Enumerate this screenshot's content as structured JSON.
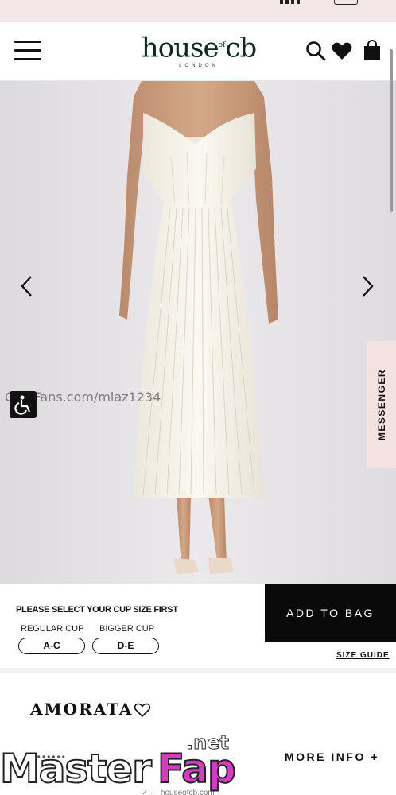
{
  "header": {
    "logo_brand": "house",
    "logo_brand_mid": "of",
    "logo_brand_end": "cb",
    "logo_sub": "LONDON"
  },
  "gallery": {
    "watermark": "OnlyFans.com/miaz1234",
    "messenger_label": "MESSENGER"
  },
  "cup_select": {
    "heading": "PLEASE SELECT YOUR CUP SIZE FIRST",
    "regular_label": "REGULAR CUP",
    "bigger_label": "BIGGER CUP",
    "regular_value": "A-C",
    "bigger_value": "D-E",
    "add_to_bag": "ADD TO BAG",
    "size_guide": "SIZE GUIDE"
  },
  "product": {
    "name": "AMORATA",
    "price": "£••••••",
    "more_info": "MORE INFO +",
    "url": "✓ ··· houseofcb.com"
  },
  "overlay": {
    "part1": "Master",
    "part2": "Fap",
    "part3": ".net"
  },
  "colors": {
    "status_bar": "#f3e6e8",
    "brand": "#0d2a22",
    "button_dark": "#0a0a0a",
    "messenger_bg": "#f4e2e1",
    "dress": "#f6f3ea",
    "photo_bg": "#e6e4e6"
  }
}
